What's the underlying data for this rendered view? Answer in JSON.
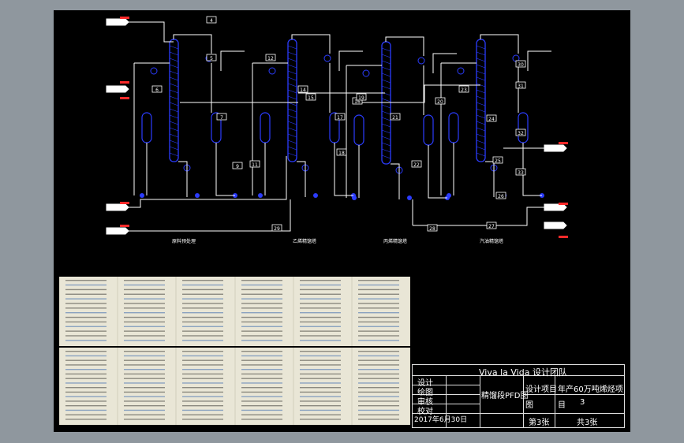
{
  "flowsheet": {
    "section_labels": [
      "原料预处理",
      "乙烯精馏塔",
      "丙烯精馏塔",
      "汽油精馏塔"
    ],
    "stream_numbers": [
      "4",
      "5",
      "6",
      "7",
      "9",
      "11",
      "12",
      "14",
      "15",
      "16",
      "17",
      "18",
      "19",
      "20",
      "21",
      "22",
      "23",
      "24",
      "25",
      "26",
      "27",
      "28",
      "29",
      "30",
      "31",
      "32",
      "33"
    ]
  },
  "title_block": {
    "team": "Viva la Vida 设计团队",
    "drawing_title": "精馏段PFD图",
    "project_label": "设计项目",
    "project_value": "年产60万吨烯烃项",
    "drawing_label": "图",
    "count_label": "目",
    "count_value": "3",
    "sheet_label": "第3张",
    "sheet_total": "共3张",
    "date": "2017年6月30日",
    "roles": [
      "设计",
      "绘图",
      "审核",
      "校对"
    ]
  },
  "colors": {
    "equipment": "#2b3cff",
    "pipe": "#ffffff",
    "stream_tag": "#ff2a2a",
    "table_bg": "#e9e6d6",
    "sheet_bg": "#000000",
    "frame_bg": "#8f979e"
  }
}
